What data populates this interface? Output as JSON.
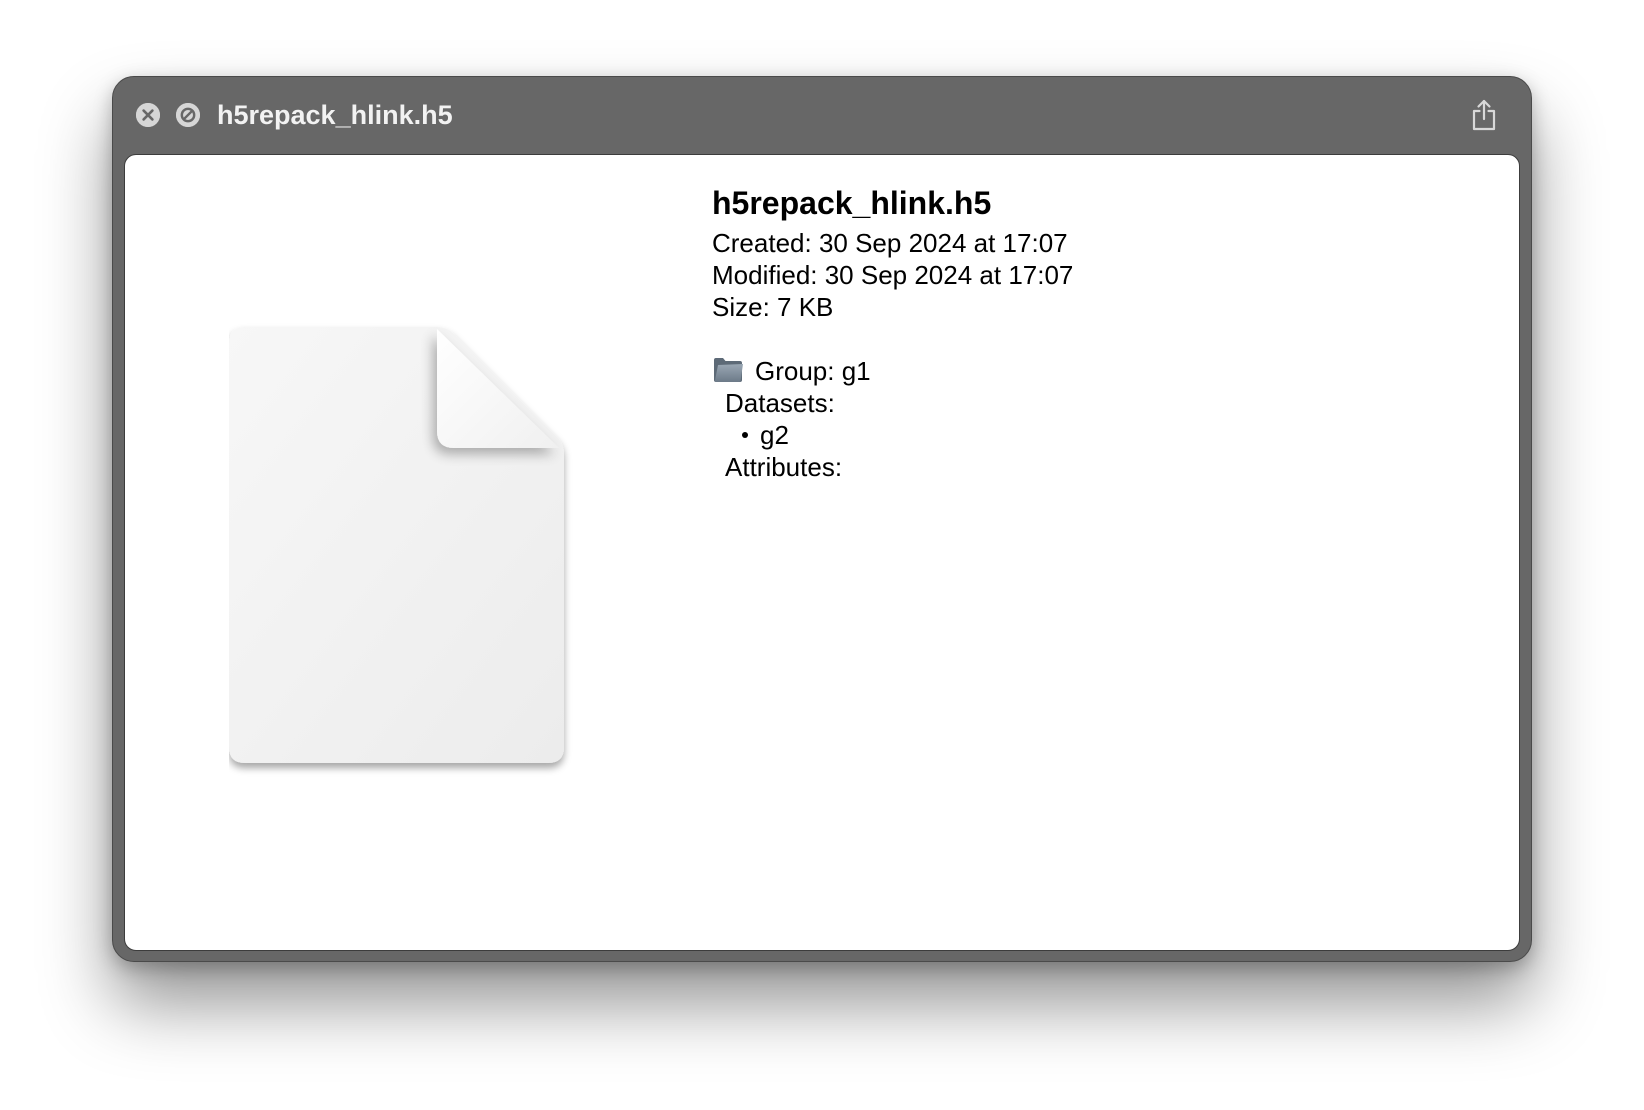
{
  "window": {
    "title": "h5repack_hlink.h5",
    "close_icon": "close-icon",
    "block_icon": "prohibited-icon",
    "share_icon": "share-icon"
  },
  "preview": {
    "icon": "generic-document-icon",
    "filename": "h5repack_hlink.h5",
    "created": "Created: 30 Sep 2024 at 17:07",
    "modified": "Modified: 30 Sep 2024 at 17:07",
    "size": "Size: 7 KB",
    "group": {
      "icon": "folder-icon",
      "label": "Group: g1",
      "datasets_label": "Datasets:",
      "datasets": [
        "g2"
      ],
      "attributes_label": "Attributes:"
    }
  },
  "colors": {
    "titlebar": "#676767",
    "content_bg": "#ffffff",
    "title_text": "#f2f2f2"
  }
}
